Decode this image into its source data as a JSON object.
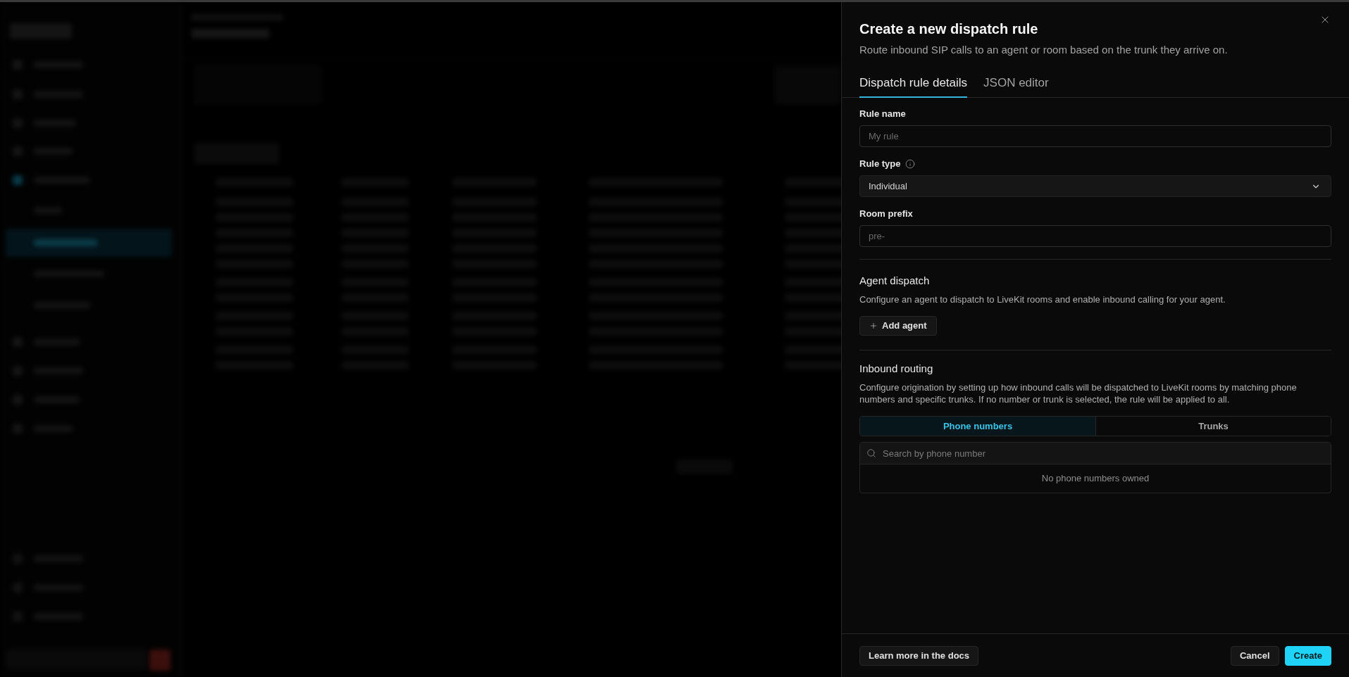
{
  "drawer": {
    "title": "Create a new dispatch rule",
    "subtitle": "Route inbound SIP calls to an agent or room based on the trunk they arrive on.",
    "tabs": [
      {
        "label": "Dispatch rule details",
        "selected": true
      },
      {
        "label": "JSON editor",
        "selected": false
      }
    ],
    "fields": [
      {
        "kind": "input",
        "label": "Rule name",
        "placeholder": "My rule"
      },
      {
        "kind": "select",
        "label": "Rule type",
        "info": true,
        "value": "Individual"
      },
      {
        "kind": "input",
        "label": "Room prefix",
        "placeholder": "pre-"
      }
    ],
    "agent_dispatch": {
      "heading": "Agent dispatch",
      "description": "Configure an agent to dispatch to LiveKit rooms and enable inbound calling for your agent.",
      "button": "Add agent"
    },
    "inbound_routing": {
      "heading": "Inbound routing",
      "description": "Configure origination by setting up how inbound calls will be dispatched to LiveKit rooms by matching phone numbers and specific trunks. If no number or trunk is selected, the rule will be applied to all.",
      "segments": [
        {
          "label": "Phone numbers",
          "selected": true
        },
        {
          "label": "Trunks",
          "selected": false
        }
      ],
      "search": {
        "placeholder": "Search by phone number"
      },
      "empty_message": "No phone numbers owned"
    },
    "footer": {
      "docs_link": "Learn more in the docs",
      "buttons": [
        {
          "label": "Cancel",
          "kind": "secondary"
        },
        {
          "label": "Create",
          "kind": "primary"
        }
      ]
    }
  }
}
